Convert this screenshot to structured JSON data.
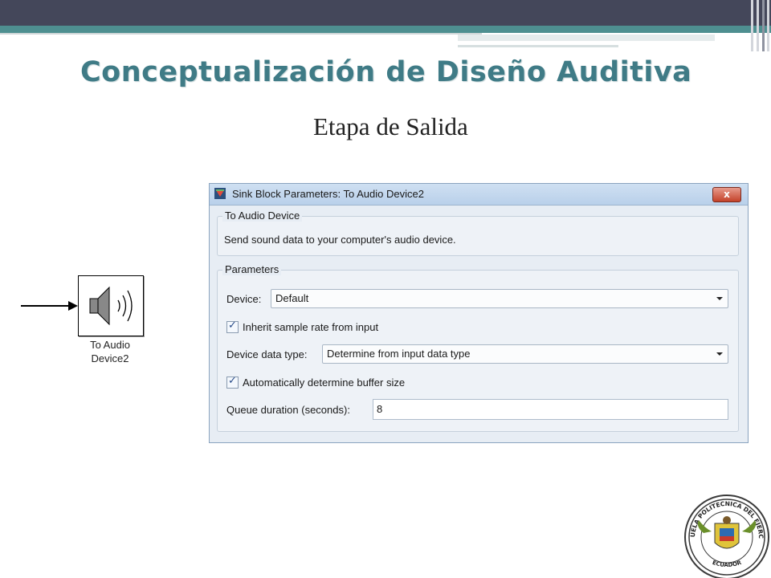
{
  "slide": {
    "title": "Conceptualización de Diseño Auditiva",
    "subtitle": "Etapa de Salida"
  },
  "block": {
    "label_line1": "To Audio",
    "label_line2": "Device2"
  },
  "dialog": {
    "title": "Sink Block Parameters: To Audio Device2",
    "close_label": "x",
    "section1": {
      "legend": "To Audio Device",
      "description": "Send sound data to your computer's audio device."
    },
    "section2": {
      "legend": "Parameters",
      "device_label": "Device:",
      "device_value": "Default",
      "inherit_label": "Inherit sample rate from input",
      "inherit_checked": true,
      "datatype_label": "Device data type:",
      "datatype_value": "Determine from input data type",
      "buffer_label": "Automatically determine buffer size",
      "buffer_checked": true,
      "queue_label": "Queue duration (seconds):",
      "queue_value": "8"
    }
  },
  "emblem": {
    "arc_text": "ESCUELA POLITECNICA DEL EJERCITO",
    "bottom_text": "ECUADOR"
  },
  "colors": {
    "title": "#3f7b86",
    "top_bar": "#44475a",
    "teal_bar": "#4e8f90"
  }
}
